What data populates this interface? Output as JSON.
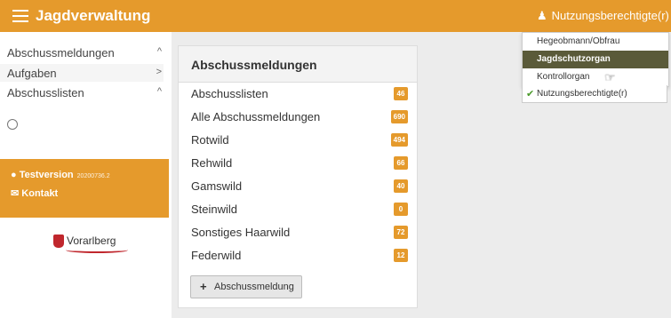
{
  "header": {
    "app_title": "Jagdverwaltung",
    "user_role": "Nutzungsberechtigte(r)"
  },
  "sidebar": {
    "items": [
      {
        "label": "Abschussmeldungen",
        "chevron": "^"
      },
      {
        "label": "Aufgaben",
        "chevron": ">"
      },
      {
        "label": "Abschusslisten",
        "chevron": "^"
      }
    ],
    "promo": {
      "version_label": "Testversion",
      "version_number": "20200736.2",
      "contact_label": "Kontakt"
    },
    "logo_text": "Vorarlberg"
  },
  "card": {
    "title": "Abschussmeldungen",
    "items": [
      {
        "label": "Abschusslisten",
        "count": "46"
      },
      {
        "label": "Alle Abschussmeldungen",
        "count": "690"
      },
      {
        "label": "Rotwild",
        "count": "494"
      },
      {
        "label": "Rehwild",
        "count": "66"
      },
      {
        "label": "Gamswild",
        "count": "40"
      },
      {
        "label": "Steinwild",
        "count": "0"
      },
      {
        "label": "Sonstiges Haarwild",
        "count": "72"
      },
      {
        "label": "Federwild",
        "count": "12"
      }
    ],
    "add_button": "Abschussmeldung"
  },
  "dropdown": {
    "items": [
      {
        "label": "Hegeobmann/Obfrau"
      },
      {
        "label": "Jagdschutzorgan"
      },
      {
        "label": "Kontrollorgan"
      },
      {
        "label": "Nutzungsberechtigte(r)"
      }
    ]
  },
  "colors": {
    "accent": "#e59a2c",
    "active_item": "#5a5a39",
    "check": "#4a9a2a"
  }
}
